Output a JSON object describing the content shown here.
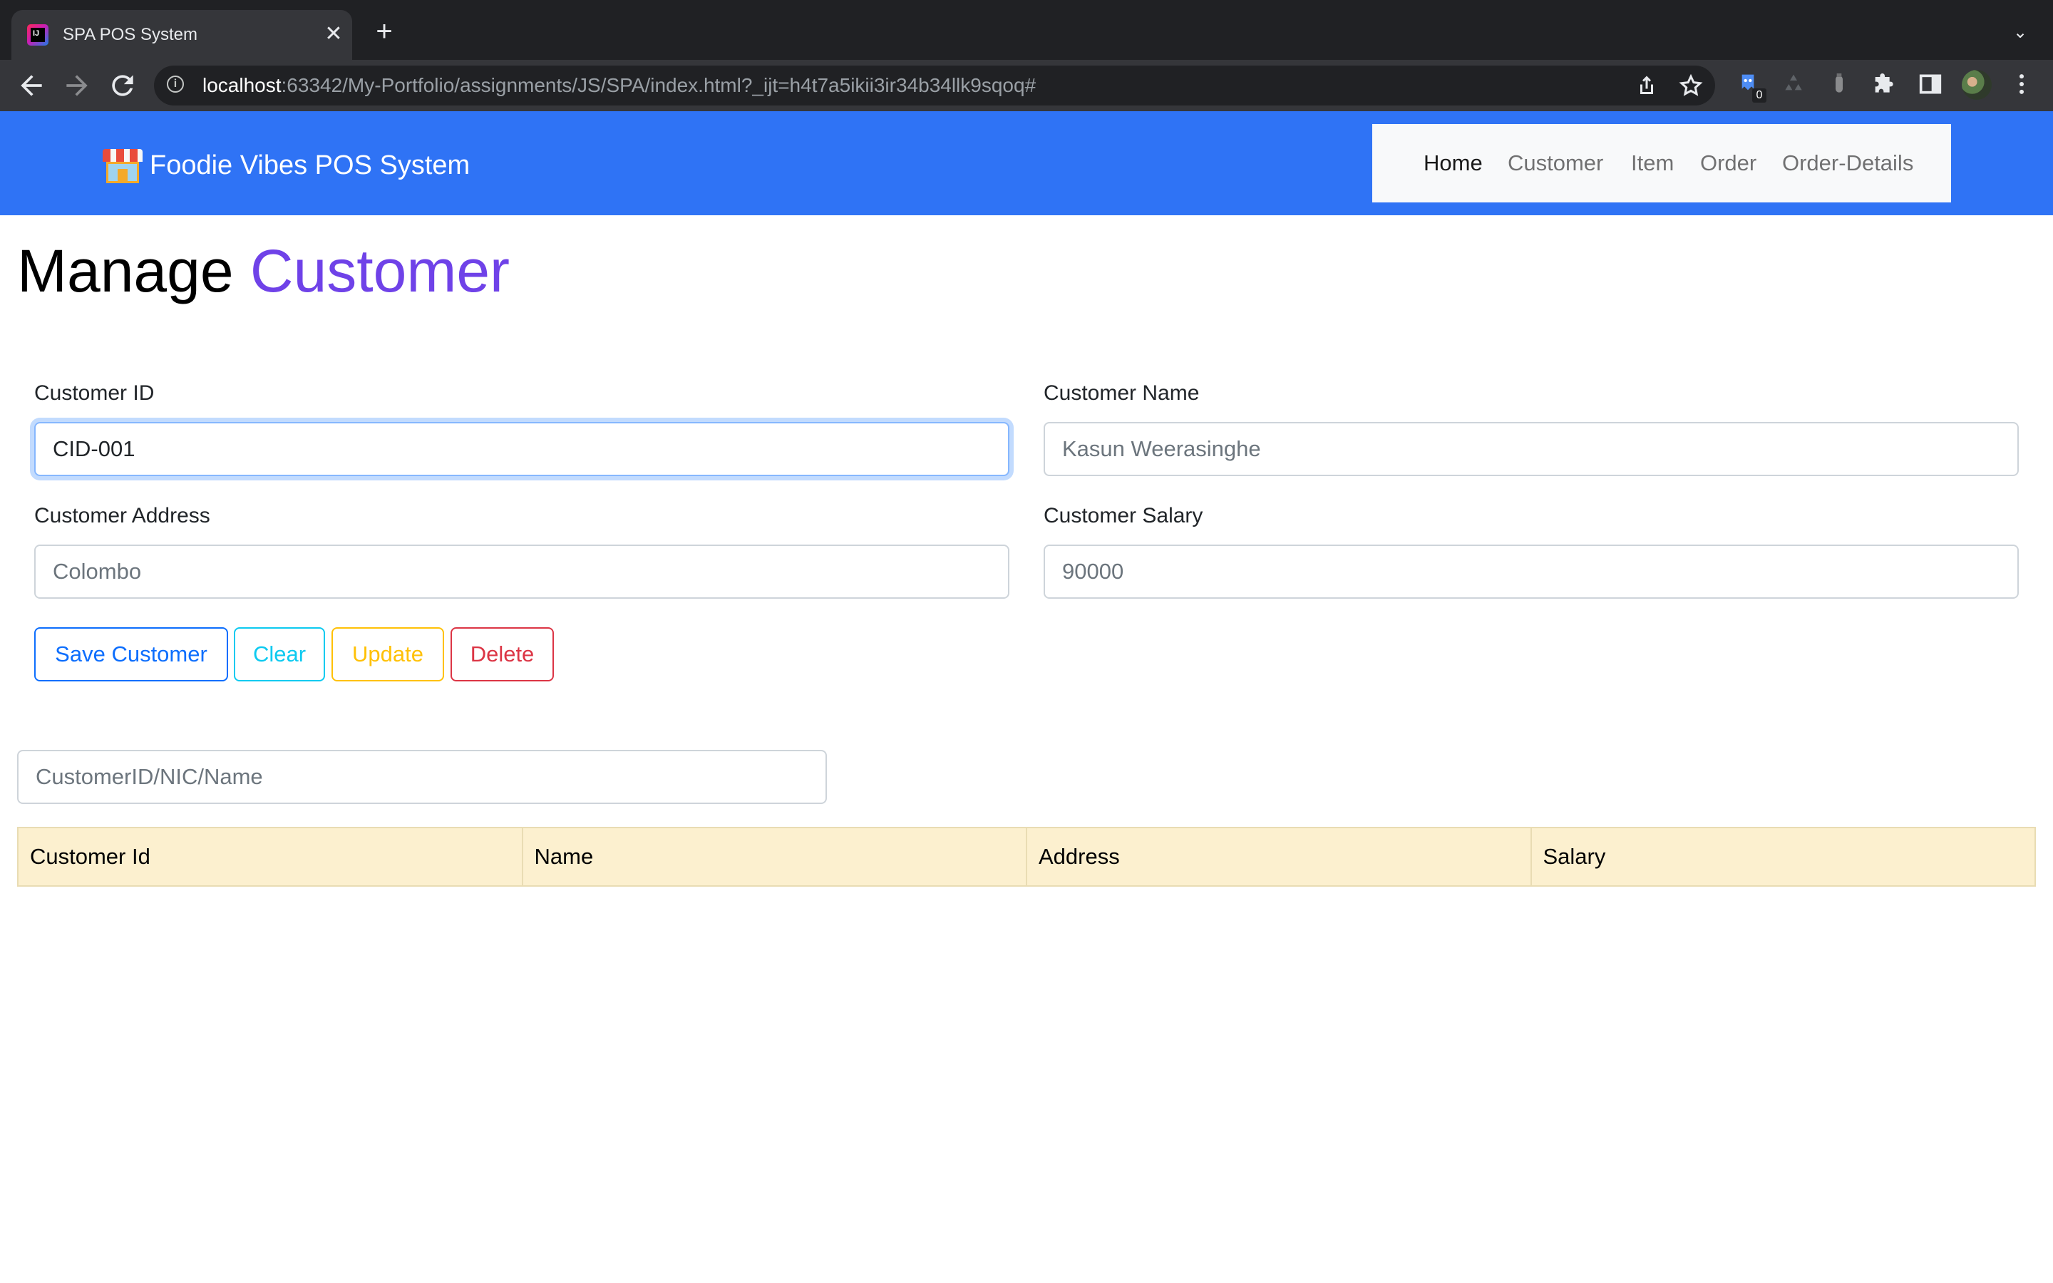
{
  "browser": {
    "tab_title": "SPA POS System",
    "tab_favicon_text": "IJ",
    "close_glyph": "✕",
    "new_tab_glyph": "+",
    "tabs_menu_glyph": "⌄",
    "url_host": "localhost",
    "url_path": ":63342/My-Portfolio/assignments/JS/SPA/index.html?_ijt=h4t7a5ikii3ir34b34llk9sqoq#",
    "extension_badge": "0",
    "icons": [
      "back-arrow-icon",
      "forward-arrow-icon",
      "reload-icon",
      "info-icon",
      "share-icon",
      "star-icon",
      "extension-icon",
      "puzzle-icon",
      "sidepanel-icon",
      "menu-dots-icon"
    ]
  },
  "navbar": {
    "brand": "Foodie Vibes POS System",
    "brand_icon": "store-icon",
    "background": "#2f73f5",
    "links": [
      {
        "label": "Home",
        "active": true
      },
      {
        "label": "Customer",
        "active": false
      },
      {
        "label": "Item",
        "active": false
      },
      {
        "label": "Order",
        "active": false
      },
      {
        "label": "Order-Details",
        "active": false
      }
    ]
  },
  "page": {
    "title_main": "Manage",
    "title_accent": "Customer",
    "accent_color": "#6f42e8"
  },
  "form": {
    "customer_id": {
      "label": "Customer ID",
      "value": "CID-001"
    },
    "customer_name": {
      "label": "Customer Name",
      "placeholder": "Kasun Weerasinghe"
    },
    "customer_address": {
      "label": "Customer Address",
      "placeholder": "Colombo"
    },
    "customer_salary": {
      "label": "Customer Salary",
      "placeholder": "90000"
    }
  },
  "buttons": {
    "save": "Save Customer",
    "clear": "Clear",
    "update": "Update",
    "delete": "Delete"
  },
  "search": {
    "placeholder": "CustomerID/NIC/Name"
  },
  "table": {
    "columns": [
      "Customer Id",
      "Name",
      "Address",
      "Salary"
    ],
    "rows": []
  }
}
